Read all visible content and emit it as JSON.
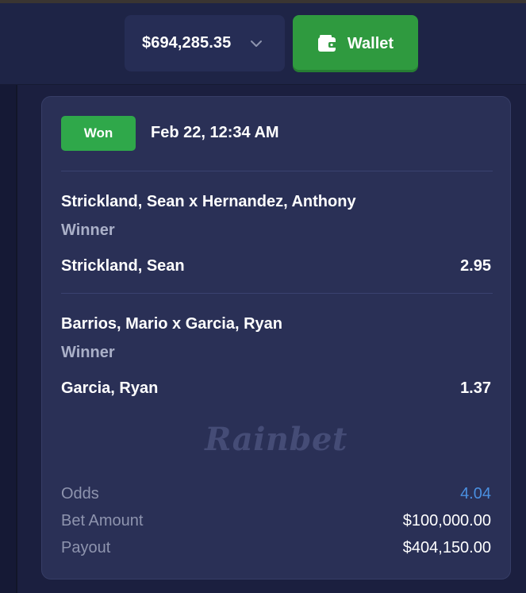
{
  "header": {
    "balance": "$694,285.35",
    "wallet_label": "Wallet"
  },
  "bet": {
    "status": "Won",
    "date": "Feb 22, 12:34 AM",
    "legs": [
      {
        "event": "Strickland, Sean x Hernandez, Anthony",
        "market": "Winner",
        "selection": "Strickland, Sean",
        "odds": "2.95"
      },
      {
        "event": "Barrios, Mario x Garcia, Ryan",
        "market": "Winner",
        "selection": "Garcia, Ryan",
        "odds": "1.37"
      }
    ],
    "watermark": "Rainbet",
    "summary": {
      "odds_label": "Odds",
      "odds_value": "4.04",
      "bet_amount_label": "Bet Amount",
      "bet_amount_value": "$100,000.00",
      "payout_label": "Payout",
      "payout_value": "$404,150.00"
    }
  },
  "colors": {
    "page_bg": "#1b1f3f",
    "header_bg": "#1e2446",
    "card_bg": "#2a3056",
    "won_green": "#2fa84a",
    "wallet_green": "#2f9a3f",
    "odds_accent": "#4a8fe0",
    "muted_text": "#8e94ae"
  },
  "icons": {
    "balance_dropdown": "chevron-down-icon",
    "wallet": "wallet-icon"
  }
}
